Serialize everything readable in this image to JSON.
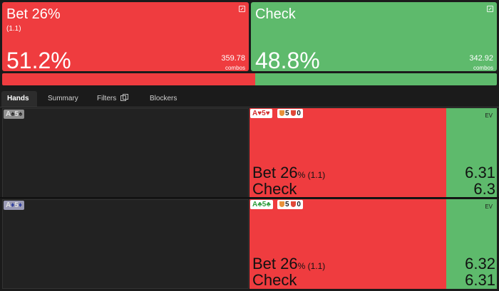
{
  "actions": {
    "bet": {
      "title": "Bet 26%",
      "sub": "(1.1)",
      "pct": "51.2%",
      "combos": "359.78",
      "combos_label": "combos",
      "freq": 51.2,
      "color": "#ef3c3f"
    },
    "check": {
      "title": "Check",
      "pct": "48.8%",
      "combos": "342.92",
      "combos_label": "combos",
      "freq": 48.8,
      "color": "#5eba6c"
    }
  },
  "tabs": {
    "hands": "Hands",
    "summary": "Summary",
    "filters": "Filters",
    "blockers": "Blockers"
  },
  "rows": [
    {
      "hand_rank1": "A",
      "hand_suit1": "♠",
      "hand_rank2": "5",
      "hand_suit2": "♠",
      "badge_rank1": "A",
      "badge_suit1": "♥",
      "badge_rank2": "5",
      "badge_suit2": "♥",
      "badge_color": "#d32f2f",
      "blocker_a": "5",
      "blocker_b": "0",
      "bet_label": "Bet 26",
      "bet_suffix": "% (1.1)",
      "check_label": "Check",
      "ev_label": "EV",
      "ev_bet": "6.31",
      "ev_check": "6.3"
    },
    {
      "hand_rank1": "A",
      "hand_suit1": "♦",
      "hand_rank2": "5",
      "hand_suit2": "♦",
      "badge_rank1": "A",
      "badge_suit1": "♣",
      "badge_rank2": "5",
      "badge_suit2": "♣",
      "badge_color": "#2e9e3c",
      "blocker_a": "5",
      "blocker_b": "0",
      "bet_label": "Bet 26",
      "bet_suffix": "% (1.1)",
      "check_label": "Check",
      "ev_label": "EV",
      "ev_bet": "6.32",
      "ev_check": "6.31"
    }
  ]
}
